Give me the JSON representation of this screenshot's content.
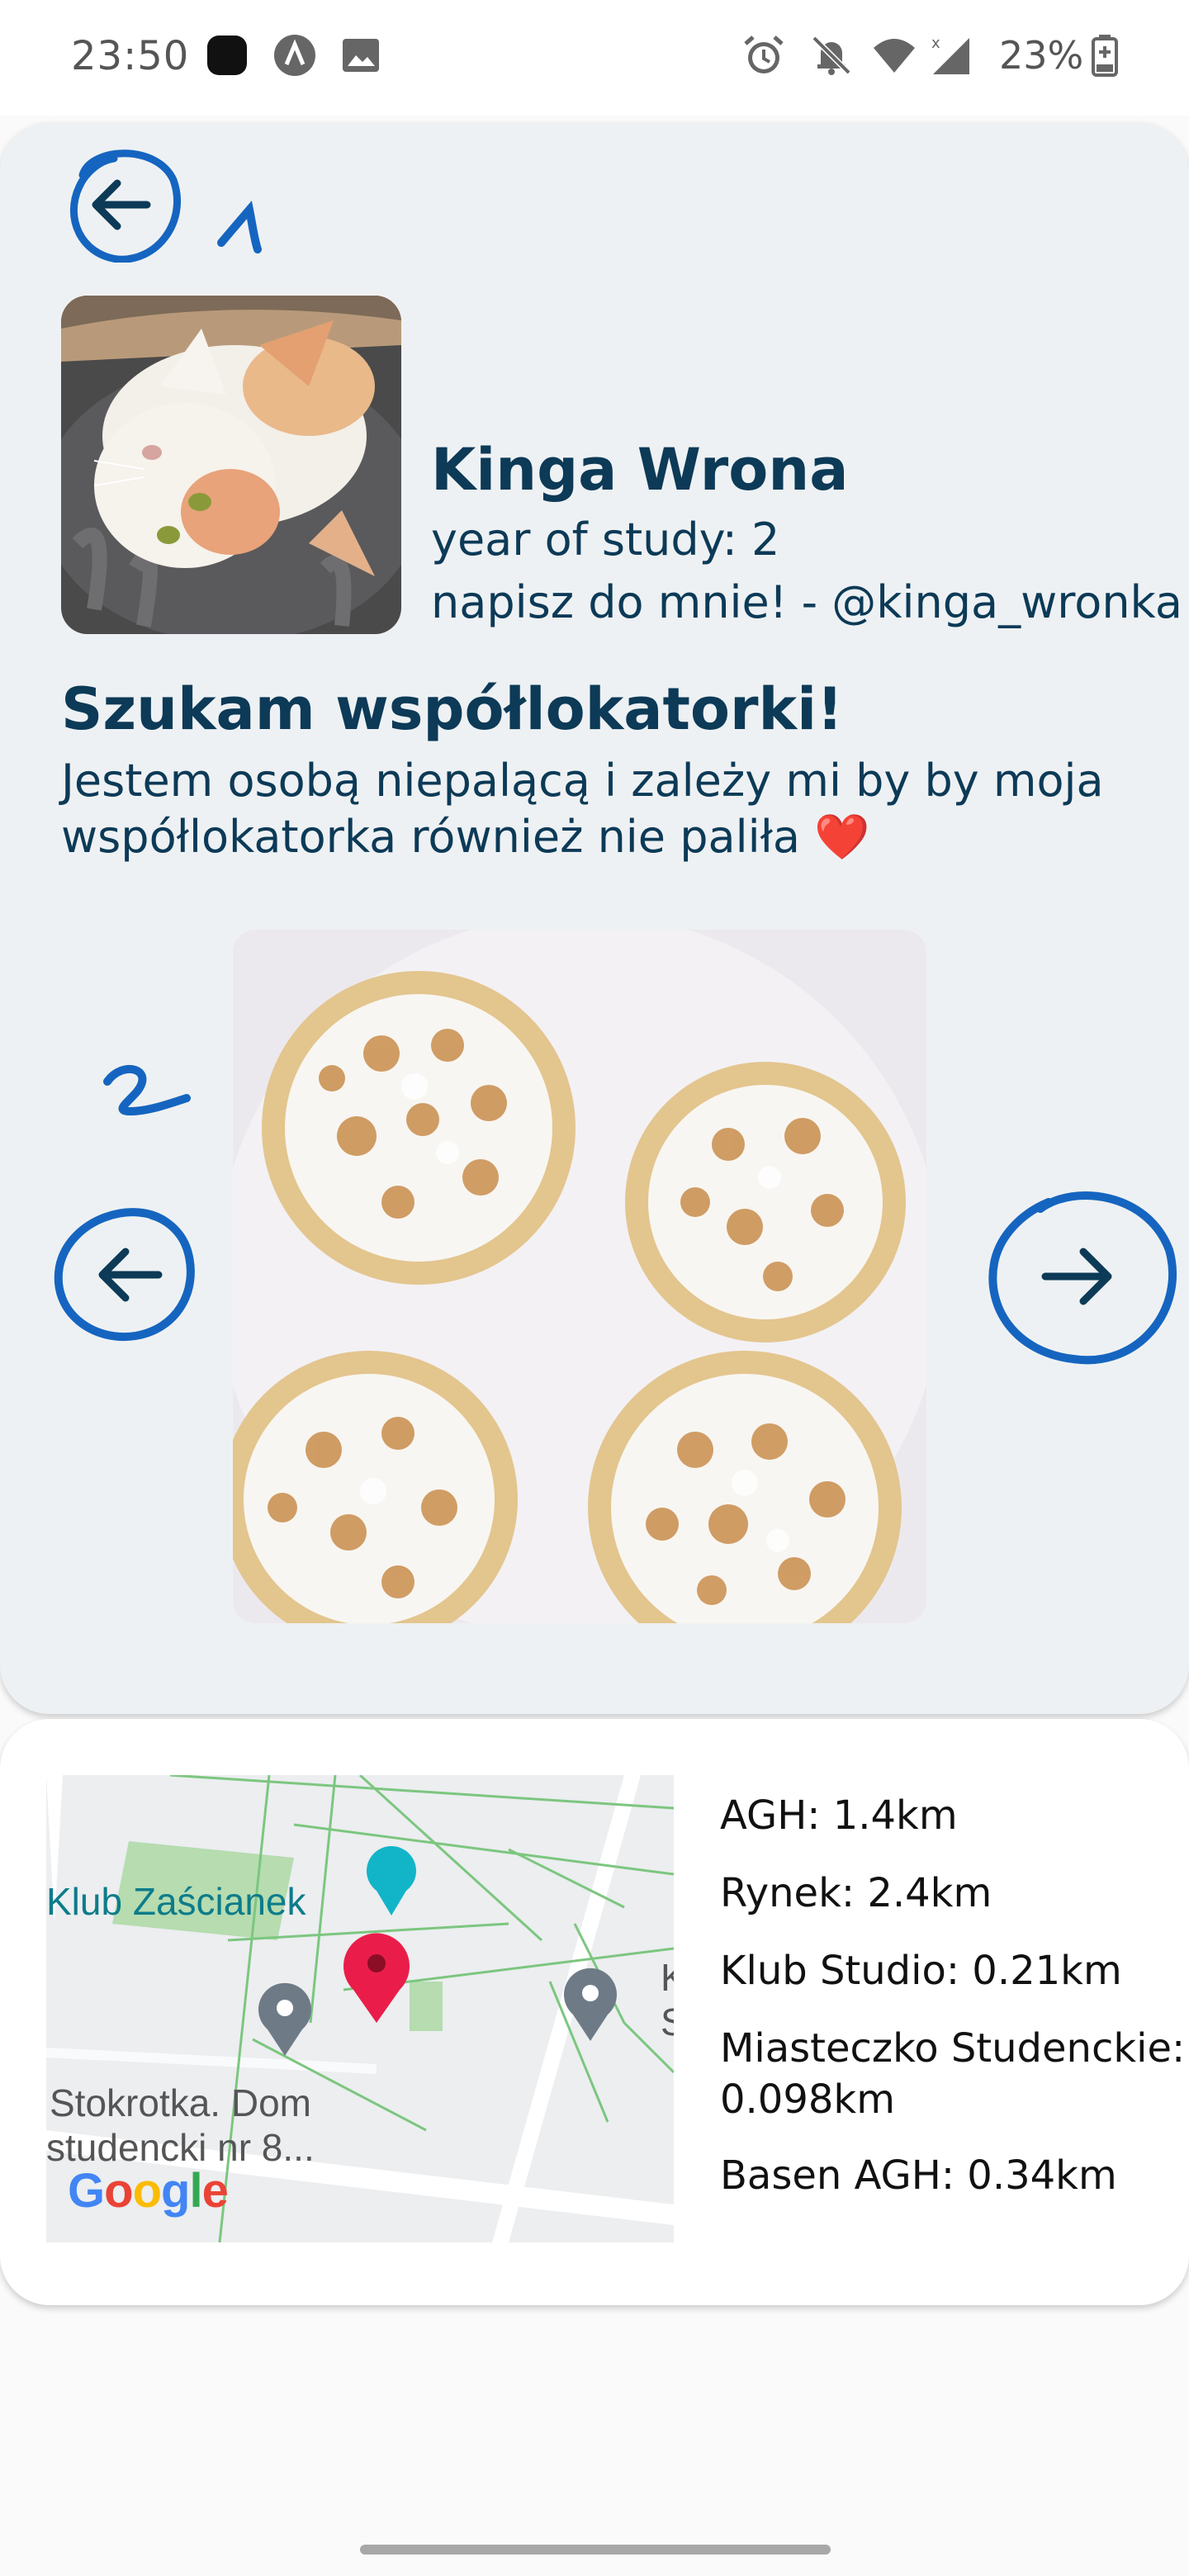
{
  "status_bar": {
    "time": "23:50",
    "battery": "23%",
    "icons": [
      "app-icon",
      "a-icon",
      "image-icon",
      "alarm-icon",
      "bell-off-icon",
      "wifi-icon",
      "signal-icon",
      "battery-icon"
    ]
  },
  "profile": {
    "name": "Kinga Wrona",
    "year": "year of study: 2",
    "contact": "napisz do mnie! - @kinga_wronka"
  },
  "listing": {
    "title": "Szukam współlokatorki!",
    "description": "Jestem osobą niepalącą i zależy mi by by moja współlokatorka również nie paliła",
    "description_emoji": "❤️"
  },
  "annotations": {
    "first": "1",
    "second": "2"
  },
  "map": {
    "labels": [
      "Klub Zaścianek",
      "Stokrotka. Dom",
      "studencki nr 8...",
      "K",
      "S"
    ],
    "logo": "Google"
  },
  "distances": [
    "AGH: 1.4km",
    "Rynek: 2.4km",
    "Klub Studio: 0.21km",
    "Miasteczko Studenckie:",
    "0.098km",
    "Basen AGH: 0.34km"
  ],
  "colors": {
    "primary": "#0c3a57",
    "card": "#eef1f3",
    "annotation": "#1565c0",
    "pin": "#ea1d4a"
  }
}
